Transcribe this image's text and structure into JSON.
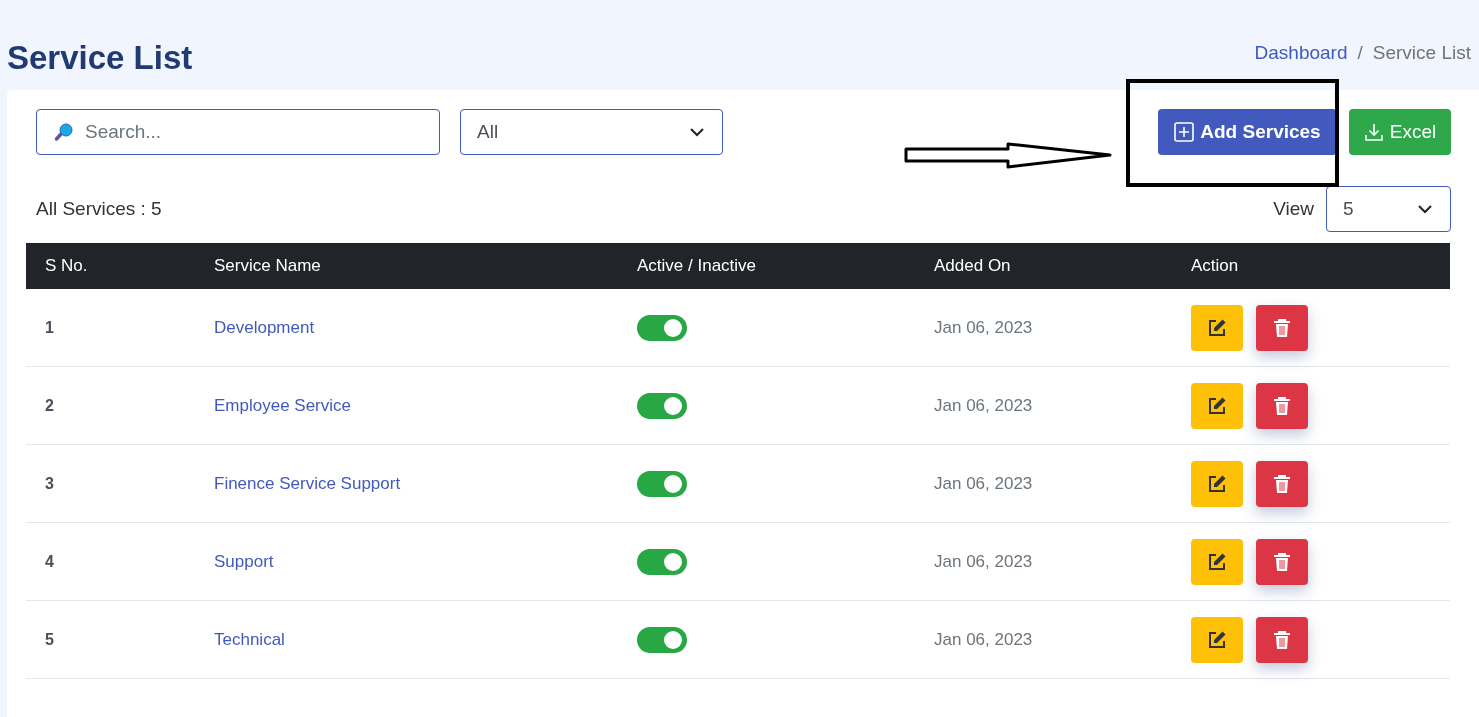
{
  "page_title": "Service List",
  "breadcrumb": [
    {
      "kind": "link",
      "label": "Dashboard"
    },
    {
      "kind": "separator",
      "label": "/"
    },
    {
      "kind": "current",
      "label": "Service List"
    }
  ],
  "search": {
    "placeholder": "Search..."
  },
  "filter": {
    "value": "All"
  },
  "buttons": [
    {
      "kind": "add",
      "label": "Add Services"
    },
    {
      "kind": "excel",
      "label": "Excel"
    }
  ],
  "count_label": "All Services : 5",
  "view": {
    "label": "View",
    "value": "5"
  },
  "table": {
    "columns": [
      "S No.",
      "Service Name",
      "Active / Inactive",
      "Added On",
      "Action"
    ],
    "rows": [
      {
        "s_no": "1",
        "name": "Development",
        "active": true,
        "added_on": "Jan 06, 2023"
      },
      {
        "s_no": "2",
        "name": "Employee Service",
        "active": true,
        "added_on": "Jan 06, 2023"
      },
      {
        "s_no": "3",
        "name": "Finence Service Support",
        "active": true,
        "added_on": "Jan 06, 2023"
      },
      {
        "s_no": "4",
        "name": "Support",
        "active": true,
        "added_on": "Jan 06, 2023"
      },
      {
        "s_no": "5",
        "name": "Technical",
        "active": true,
        "added_on": "Jan 06, 2023"
      }
    ]
  }
}
